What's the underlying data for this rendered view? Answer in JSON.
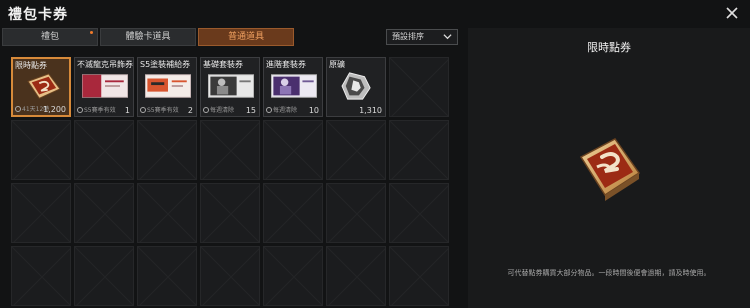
{
  "window": {
    "title": "禮包卡券",
    "close_icon": "close-icon"
  },
  "tabs": [
    {
      "label": "禮包",
      "has_notification": true
    },
    {
      "label": "體驗卡道具",
      "has_notification": false
    },
    {
      "label": "普通道具",
      "has_notification": false,
      "active": true
    }
  ],
  "sort": {
    "selected": "預設排序",
    "icon": "chevron-down-icon"
  },
  "items": [
    {
      "name": "限時點券",
      "foot": "41天12時",
      "count": "1,200",
      "icon": "point-coupon-icon",
      "selected": true
    },
    {
      "name": "不滅龍克吊飾券",
      "foot": "S5賽季有效",
      "count": "1",
      "icon": "pendant-coupon-icon"
    },
    {
      "name": "S5塗裝補給券",
      "foot": "S5賽季有效",
      "count": "2",
      "icon": "skin-coupon-icon"
    },
    {
      "name": "基礎套裝券",
      "foot": "每週清除",
      "count": "15",
      "icon": "basic-outfit-coupon-icon"
    },
    {
      "name": "進階套裝券",
      "foot": "每週清除",
      "count": "10",
      "icon": "advanced-outfit-coupon-icon"
    },
    {
      "name": "原礦",
      "foot": "",
      "count": "1,310",
      "icon": "ore-icon"
    }
  ],
  "detail": {
    "title": "限時點券",
    "icon": "point-coupon-icon",
    "description": "可代替點券購買大部分物品。一段時間後便會過期，請及時使用。"
  },
  "colors": {
    "accent": "#d78a3a",
    "active_tab": "#6a3a1c",
    "background": "#121314"
  }
}
